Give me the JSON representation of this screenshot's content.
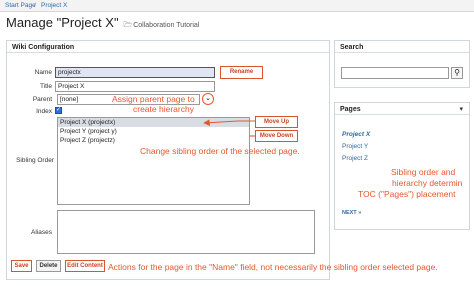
{
  "breadcrumbs": [
    "Start Page",
    "/",
    "Project X"
  ],
  "page": {
    "title": "Manage \"Project X\"",
    "folder_icon": "folder-icon",
    "folder_label": "Collaboration Tutorial"
  },
  "wiki": {
    "panel_title": "Wiki Configuration",
    "name_label": "Name",
    "name_value": "projectx",
    "title_label": "Title",
    "title_value": "Project X",
    "parent_label": "Parent",
    "parent_value": "[none]",
    "index_label": "Index",
    "sibling_label": "Sibling Order",
    "siblings": [
      "Project X (projectx)",
      "Project Y (project y)",
      "Project Z (projectz)"
    ],
    "aliases_label": "Aliases",
    "rename_button": "Rename",
    "move_up_button": "Move Up",
    "move_down_button": "Move Down",
    "save_button": "Save",
    "delete_button": "Delete",
    "edit_content_button": "Edit Content"
  },
  "search": {
    "title": "Search",
    "icon": "search-icon"
  },
  "pages": {
    "title": "Pages",
    "items": [
      "Project X",
      "Project Y",
      "Project Z"
    ],
    "next_label": "NEXT »"
  },
  "annotations": {
    "parent_note_1": "Assign parent page to",
    "parent_note_2": "create hierarchy",
    "sibling_note": "Change sibling order of the selected page.",
    "toc_note_1": "Sibling order and",
    "toc_note_2": "hierarchy determin",
    "toc_note_3": "TOC (\"Pages\") placement",
    "actions_note": "Actions for the page in the \"Name\" field, not necessarily the sibling order selected page."
  },
  "colors": {
    "accent": "#e4572e",
    "link": "#2a6aa8"
  }
}
